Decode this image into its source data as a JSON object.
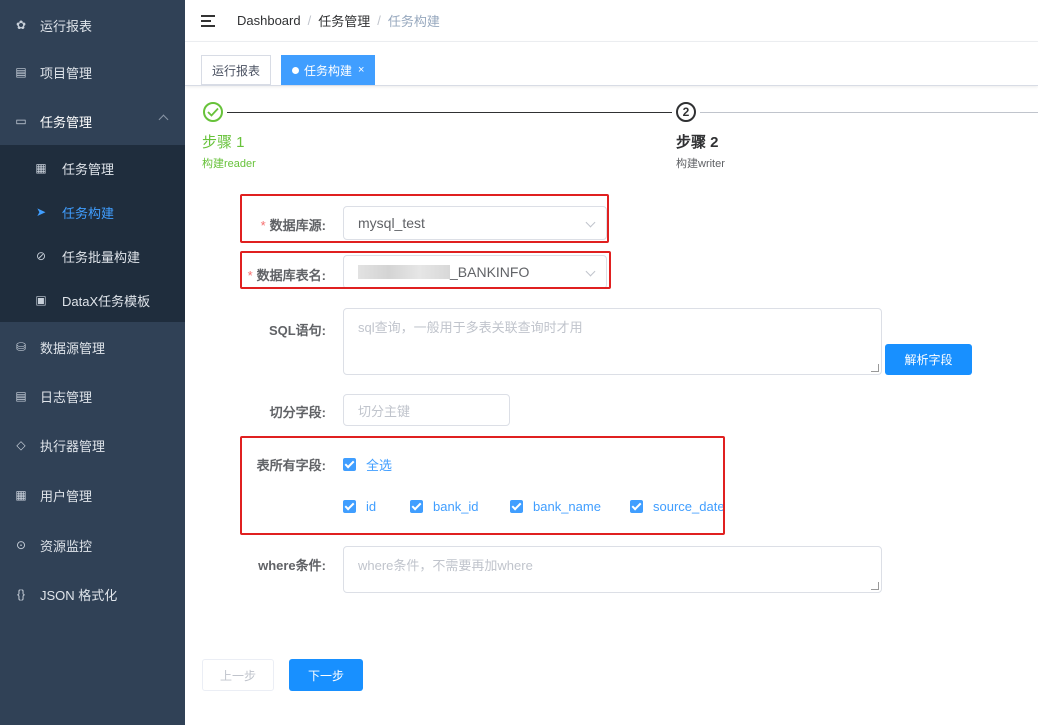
{
  "sidebar": {
    "items": [
      {
        "label": "运行报表",
        "icon": "dashboard-icon"
      },
      {
        "label": "项目管理",
        "icon": "project-icon"
      },
      {
        "label": "任务管理",
        "icon": "task-icon"
      },
      {
        "label": "数据源管理",
        "icon": "database-icon"
      },
      {
        "label": "日志管理",
        "icon": "log-icon"
      },
      {
        "label": "执行器管理",
        "icon": "executor-icon"
      },
      {
        "label": "用户管理",
        "icon": "user-icon"
      },
      {
        "label": "资源监控",
        "icon": "monitor-icon"
      },
      {
        "label": "JSON 格式化",
        "icon": "braces-icon"
      }
    ],
    "submenu": [
      {
        "label": "任务管理",
        "icon": "task-list-icon"
      },
      {
        "label": "任务构建",
        "icon": "send-icon"
      },
      {
        "label": "任务批量构建",
        "icon": "batch-icon"
      },
      {
        "label": "DataX任务模板",
        "icon": "template-icon"
      }
    ],
    "active_color": "#409eff",
    "bg": "#304156"
  },
  "breadcrumb": {
    "items": [
      "Dashboard",
      "任务管理",
      "任务构建"
    ],
    "separator": "/"
  },
  "tags": [
    {
      "label": "运行报表"
    },
    {
      "label": "任务构建",
      "close": "×"
    }
  ],
  "steps": [
    {
      "num": "",
      "title": "步骤 1",
      "desc": "构建reader"
    },
    {
      "num": "2",
      "title": "步骤 2",
      "desc": "构建writer"
    }
  ],
  "form": {
    "datasource": {
      "label": "数据库源:",
      "required": "*",
      "value": "mysql_test"
    },
    "table": {
      "label": "数据库表名:",
      "required": "*",
      "value": "_BANKINFO"
    },
    "sql": {
      "label": "SQL语句:",
      "placeholder": "sql查询，一般用于多表关联查询时才用"
    },
    "parse_button": "解析字段",
    "split": {
      "label": "切分字段:",
      "placeholder": "切分主键"
    },
    "fields": {
      "label": "表所有字段:",
      "select_all": "全选",
      "columns": [
        "id",
        "bank_id",
        "bank_name",
        "source_date"
      ]
    },
    "where": {
      "label": "where条件:",
      "placeholder": "where条件，不需要再加where"
    }
  },
  "buttons": {
    "prev": "上一步",
    "next": "下一步"
  },
  "colors": {
    "primary": "#1890ff",
    "success": "#67c23a",
    "highlight": "#e02020"
  }
}
